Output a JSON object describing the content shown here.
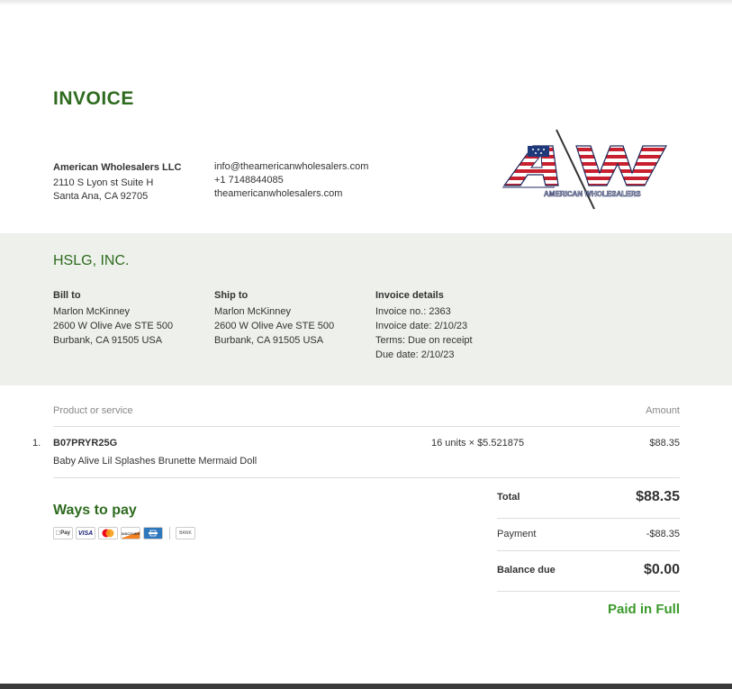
{
  "document": {
    "title": "INVOICE"
  },
  "seller": {
    "name": "American Wholesalers LLC",
    "address_line1": "2110 S Lyon st Suite H",
    "address_line2": "Santa Ana, CA 92705",
    "email": "info@theamericanwholesalers.com",
    "phone": "+1 7148844085",
    "website": "theamericanwholesalers.com",
    "logo_text": "AMERICAN WHOLESALERS"
  },
  "customer": {
    "name": "HSLG, INC."
  },
  "bill_to": {
    "heading": "Bill to",
    "name": "Marlon McKinney",
    "line1": "2600 W Olive Ave STE 500",
    "line2": "Burbank, CA 91505 USA"
  },
  "ship_to": {
    "heading": "Ship to",
    "name": "Marlon McKinney",
    "line1": "2600 W Olive Ave STE 500",
    "line2": "Burbank, CA 91505 USA"
  },
  "invoice_details": {
    "heading": "Invoice details",
    "number": "Invoice no.: 2363",
    "date": "Invoice date: 2/10/23",
    "terms": "Terms: Due on receipt",
    "due": "Due date: 2/10/23"
  },
  "table": {
    "col_product": "Product or service",
    "col_amount": "Amount"
  },
  "items": [
    {
      "num": "1.",
      "sku": "B07PRYR25G",
      "description": "Baby Alive Lil Splashes Brunette Mermaid Doll",
      "qty": "16 units × $5.521875",
      "amount": "$88.35"
    }
  ],
  "payment_methods": {
    "heading": "Ways to pay",
    "icons": [
      "apple-pay",
      "visa",
      "mastercard",
      "discover",
      "amex",
      "bank"
    ],
    "apple_pay": "Pay",
    "visa": "VISA",
    "discover": "DISCOVER",
    "bank": "BANK"
  },
  "totals": {
    "total_label": "Total",
    "total_value": "$88.35",
    "payment_label": "Payment",
    "payment_value": "-$88.35",
    "balance_label": "Balance due",
    "balance_value": "$0.00",
    "status": "Paid in Full"
  },
  "colors": {
    "accent": "#2e6b1f",
    "paid": "#3a9a2a",
    "band": "#edf0eb"
  }
}
